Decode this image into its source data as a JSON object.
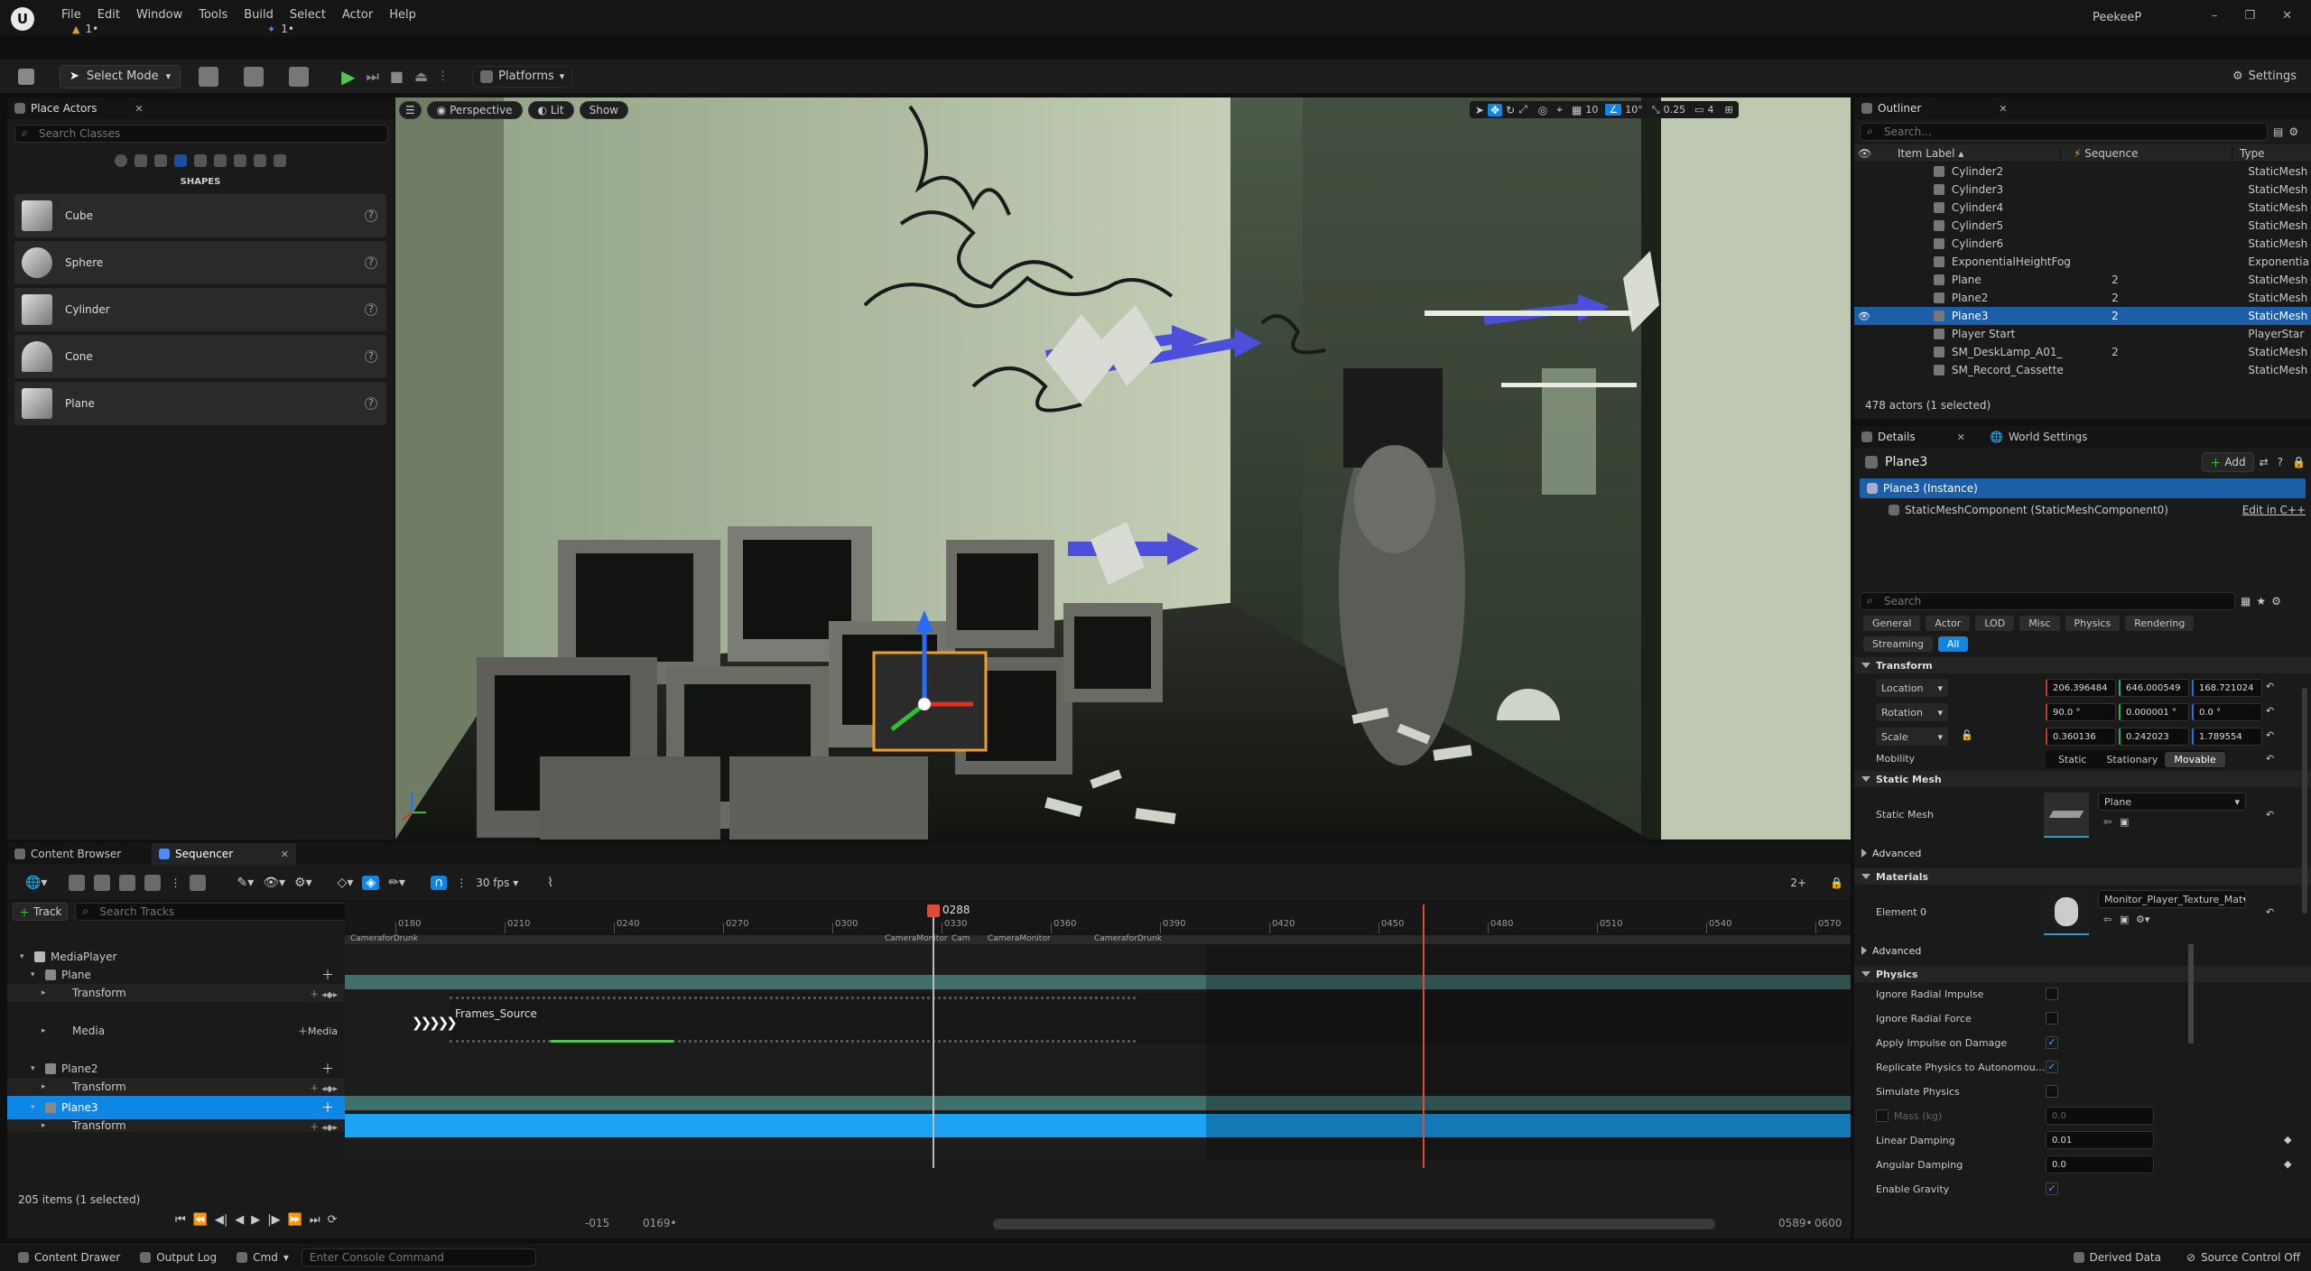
{
  "menu": {
    "items": [
      "File",
      "Edit",
      "Window",
      "Tools",
      "Build",
      "Select",
      "Actor",
      "Help"
    ],
    "user": "PeekeeP",
    "tab1": "1•",
    "tab2": "1•"
  },
  "toolbar": {
    "select_mode": "Select Mode",
    "platforms": "Platforms",
    "settings": "Settings"
  },
  "place_actors": {
    "title": "Place Actors",
    "search_placeholder": "Search Classes",
    "section": "SHAPES",
    "items": [
      "Cube",
      "Sphere",
      "Cylinder",
      "Cone",
      "Plane"
    ]
  },
  "viewport": {
    "perspective": "Perspective",
    "lit": "Lit",
    "show": "Show",
    "grid": "10",
    "angle": "10°",
    "scale": "0.25",
    "camspeed": "4"
  },
  "outliner": {
    "title": "Outliner",
    "search_placeholder": "Search...",
    "col_label": "Item Label",
    "col_sequence": "Sequence",
    "col_type": "Type",
    "rows": [
      {
        "label": "Cylinder2",
        "seq": "",
        "type": "StaticMesh"
      },
      {
        "label": "Cylinder3",
        "seq": "",
        "type": "StaticMesh"
      },
      {
        "label": "Cylinder4",
        "seq": "",
        "type": "StaticMesh"
      },
      {
        "label": "Cylinder5",
        "seq": "",
        "type": "StaticMesh"
      },
      {
        "label": "Cylinder6",
        "seq": "",
        "type": "StaticMesh"
      },
      {
        "label": "ExponentialHeightFog",
        "seq": "",
        "type": "Exponentia"
      },
      {
        "label": "Plane",
        "seq": "2",
        "type": "StaticMesh"
      },
      {
        "label": "Plane2",
        "seq": "2",
        "type": "StaticMesh"
      },
      {
        "label": "Plane3",
        "seq": "2",
        "type": "StaticMesh"
      },
      {
        "label": "Player Start",
        "seq": "",
        "type": "PlayerStar"
      },
      {
        "label": "SM_DeskLamp_A01_",
        "seq": "2",
        "type": "StaticMesh"
      },
      {
        "label": "SM_Record_Cassette",
        "seq": "",
        "type": "StaticMesh"
      }
    ],
    "status": "478 actors (1 selected)"
  },
  "details": {
    "tab": "Details",
    "tab2": "World Settings",
    "object": "Plane3",
    "add": "Add",
    "instance": "Plane3 (Instance)",
    "component": "StaticMeshComponent (StaticMeshComponent0)",
    "edit_cpp": "Edit in C++",
    "search_placeholder": "Search",
    "filters": [
      "General",
      "Actor",
      "LOD",
      "Misc",
      "Physics",
      "Rendering",
      "Streaming",
      "All"
    ],
    "transform_header": "Transform",
    "location": {
      "label": "Location",
      "x": "206.396484",
      "y": "646.000549",
      "z": "168.721024"
    },
    "rotation": {
      "label": "Rotation",
      "x": "90.0 °",
      "y": "0.000001 °",
      "z": "0.0 °"
    },
    "scale": {
      "label": "Scale",
      "x": "0.360136",
      "y": "0.242023",
      "z": "1.789554"
    },
    "mobility": {
      "label": "Mobility",
      "static": "Static",
      "stationary": "Stationary",
      "movable": "Movable"
    },
    "static_mesh_header": "Static Mesh",
    "static_mesh_label": "Static Mesh",
    "static_mesh_value": "Plane",
    "advanced": "Advanced",
    "materials_header": "Materials",
    "element0": "Element 0",
    "material_value": "Monitor_Player_Texture_Mat",
    "physics_header": "Physics",
    "physics": [
      {
        "label": "Ignore Radial Impulse",
        "checked": false
      },
      {
        "label": "Ignore Radial Force",
        "checked": false
      },
      {
        "label": "Apply Impulse on Damage",
        "checked": true
      },
      {
        "label": "Replicate Physics to Autonomou...",
        "checked": true
      },
      {
        "label": "Simulate Physics",
        "checked": false
      }
    ],
    "mass_label": "Mass (kg)",
    "mass_value": "0.0",
    "linear_damping_label": "Linear Damping",
    "linear_damping": "0.01",
    "angular_damping_label": "Angular Damping",
    "angular_damping": "0.0",
    "enable_gravity": "Enable Gravity"
  },
  "bottom_tabs": {
    "content_browser": "Content Browser",
    "sequencer": "Sequencer"
  },
  "sequencer": {
    "fps": "30 fps",
    "track_btn": "Track",
    "search_placeholder": "Search Tracks",
    "current_frame": "0288",
    "playhead": "0288",
    "zoom": "2+",
    "ticks": [
      "0180",
      "0210",
      "0240",
      "0270",
      "0300",
      "0330",
      "0360",
      "0390",
      "0420",
      "0450",
      "0480",
      "0510",
      "0540",
      "0570"
    ],
    "shot_labels": [
      "CameraforDrunk",
      "CameraMonitor",
      "Cam",
      "CameraMonitor",
      "CameraforDrunk"
    ],
    "tracks": [
      {
        "name": "MediaPlayer",
        "level": 0
      },
      {
        "name": "Plane",
        "level": 1
      },
      {
        "name": "Transform",
        "level": 2
      },
      {
        "name": "Media",
        "level": 2
      },
      {
        "name": "Plane2",
        "level": 1
      },
      {
        "name": "Transform",
        "level": 2
      },
      {
        "name": "Plane3",
        "level": 1
      },
      {
        "name": "Transform",
        "level": 2
      }
    ],
    "media_add": "Media",
    "clip_label": "Frames_Source",
    "status": "205 items (1 selected)",
    "range_start": "-015",
    "range_in": "0169•",
    "range_out": "0589•",
    "range_end": "0600"
  },
  "statusbar": {
    "content_drawer": "Content Drawer",
    "output_log": "Output Log",
    "cmd": "Cmd",
    "console_placeholder": "Enter Console Command",
    "derived": "Derived Data",
    "source_control": "Source Control Off"
  },
  "colors": {
    "accent": "#0e86e6",
    "selection": "#1a5fa8",
    "track_teal": "#3f6e6b",
    "playhead": "#e04b37"
  }
}
